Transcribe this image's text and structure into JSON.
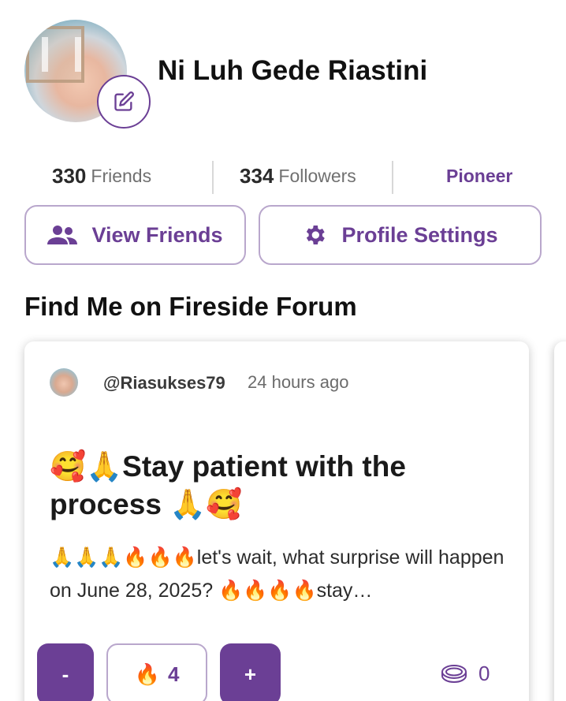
{
  "profile": {
    "name": "Ni Luh Gede Riastini",
    "avatar_icon": "profile-photo",
    "edit_icon": "pencil-square-icon"
  },
  "stats": {
    "friends_count": "330",
    "friends_label": "Friends",
    "followers_count": "334",
    "followers_label": "Followers",
    "rank": "Pioneer"
  },
  "actions": {
    "view_friends_label": "View Friends",
    "view_friends_icon": "people-icon",
    "profile_settings_label": "Profile Settings",
    "profile_settings_icon": "gear-icon"
  },
  "section": {
    "title": "Find Me on Fireside Forum"
  },
  "post": {
    "username": "@Riasukses79",
    "time": "24 hours ago",
    "title": "🥰🙏Stay patient with the process 🙏🥰",
    "body": "🙏🙏🙏🔥🔥🔥let's wait, what surprise will happen on June 28, 2025? 🔥🔥🔥🔥stay…",
    "minus_label": "-",
    "plus_label": "+",
    "fire_icon": "🔥",
    "fire_count": "4",
    "coin_icon": "coin-icon",
    "coin_count": "0"
  },
  "colors": {
    "accent": "#6b3f95",
    "border": "#b9a7cc"
  }
}
